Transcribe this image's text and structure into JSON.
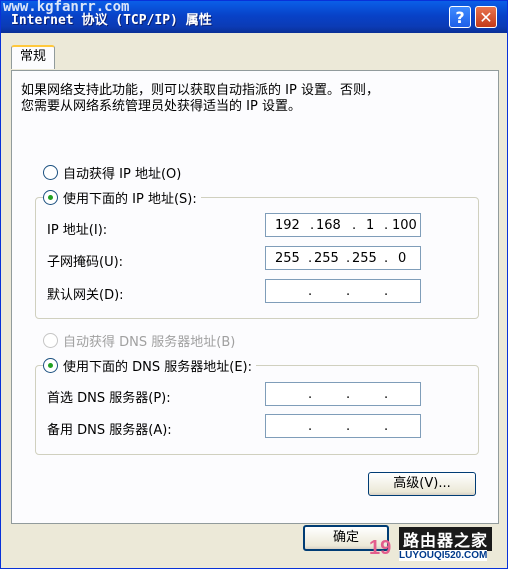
{
  "window": {
    "watermark": "www.kgfanrr.com",
    "title": "Internet 协议 (TCP/IP) 属性",
    "help_glyph": "?",
    "close_glyph": "✕"
  },
  "tabs": [
    {
      "label": "常规"
    }
  ],
  "description": {
    "line1": "如果网络支持此功能，则可以获取自动指派的 IP 设置。否则，",
    "line2": "您需要从网络系统管理员处获得适当的 IP 设置。"
  },
  "ip": {
    "auto_label": "自动获得 IP 地址(O)",
    "manual_label": "使用下面的 IP 地址(S):",
    "selected": "manual",
    "fields": [
      {
        "label": "IP 地址(I):",
        "octets": [
          "192",
          "168",
          "1",
          "100"
        ]
      },
      {
        "label": "子网掩码(U):",
        "octets": [
          "255",
          "255",
          "255",
          "0"
        ]
      },
      {
        "label": "默认网关(D):",
        "octets": [
          "",
          "",
          "",
          ""
        ]
      }
    ]
  },
  "dns": {
    "auto_label": "自动获得 DNS 服务器地址(B)",
    "manual_label": "使用下面的 DNS 服务器地址(E):",
    "selected": "manual",
    "fields": [
      {
        "label": "首选 DNS 服务器(P):",
        "octets": [
          "",
          "",
          "",
          ""
        ]
      },
      {
        "label": "备用 DNS 服务器(A):",
        "octets": [
          "",
          "",
          "",
          ""
        ]
      }
    ]
  },
  "buttons": {
    "advanced": "高级(V)...",
    "ok": "确定"
  },
  "brand": {
    "num": "19",
    "name": "路由器之家",
    "url": "LUYOUQI520.COM"
  }
}
